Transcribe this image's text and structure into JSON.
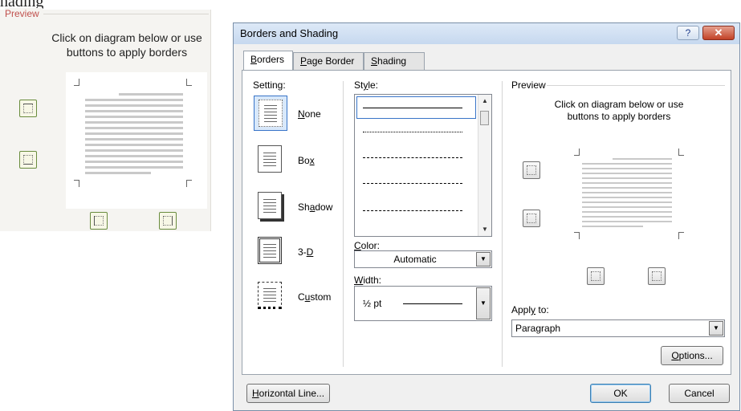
{
  "top_heading": "hading",
  "zoom_preview": {
    "title": "Preview",
    "instructions_line1": "Click on diagram below or use",
    "instructions_line2": "buttons to apply borders"
  },
  "dialog": {
    "title": "Borders and Shading",
    "help_glyph": "?",
    "close_glyph": "✕",
    "tabs": [
      {
        "label": "Borders",
        "access_key": "B",
        "rest": "orders",
        "active": true
      },
      {
        "label": "Page Border",
        "access_key": "P",
        "rest": "age Border",
        "active": false
      },
      {
        "label": "Shading",
        "access_key": "S",
        "rest": "hading",
        "active": false
      }
    ],
    "setting_label": "Setting:",
    "settings": [
      {
        "pre": "",
        "key": "N",
        "post": "one",
        "selected": true
      },
      {
        "pre": "Bo",
        "key": "x",
        "post": "",
        "selected": false
      },
      {
        "pre": "Sh",
        "key": "a",
        "post": "dow",
        "selected": false
      },
      {
        "pre": "3-",
        "key": "D",
        "post": "",
        "selected": false
      },
      {
        "pre": "C",
        "key": "u",
        "post": "stom",
        "selected": false
      }
    ],
    "style_label": {
      "pre": "St",
      "key": "y",
      "post": "le:"
    },
    "color_label": {
      "pre": "",
      "key": "C",
      "post": "olor:"
    },
    "color_value": "Automatic",
    "width_label": {
      "pre": "",
      "key": "W",
      "post": "idth:"
    },
    "width_value": "½ pt",
    "preview_title": "Preview",
    "preview_instr_line1": "Click on diagram below or use",
    "preview_instr_line2": "buttons to apply borders",
    "apply_to_label": {
      "pre": "Appl",
      "key": "y",
      "post": " to:"
    },
    "apply_to_value": "Paragraph",
    "options_button": {
      "pre": "",
      "key": "O",
      "post": "ptions..."
    },
    "horizontal_line_button": {
      "pre": "",
      "key": "H",
      "post": "orizontal Line..."
    },
    "ok_button": "OK",
    "cancel_button": "Cancel"
  },
  "colors": {
    "title_bar": "#c6d8ef",
    "close_red": "#c24126",
    "selection": "#d8e8fa",
    "zoom_button_border": "#6a8c3e",
    "preview_title_red": "#c0504d"
  }
}
